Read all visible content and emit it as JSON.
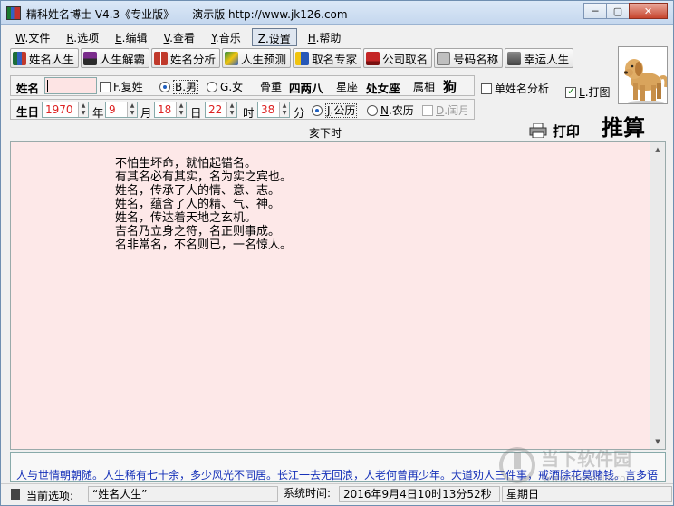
{
  "window": {
    "title": "精科姓名博士 V4.3《专业版》 - - 演示版 http://www.jk126.com",
    "min_glyph": "─",
    "max_glyph": "▢",
    "close_glyph": "✕"
  },
  "menu": [
    {
      "key": "W",
      "label": ".文件"
    },
    {
      "key": "R",
      "label": ".选项"
    },
    {
      "key": "E",
      "label": ".编辑"
    },
    {
      "key": "V",
      "label": ".查看"
    },
    {
      "key": "Y",
      "label": ".音乐"
    },
    {
      "key": "Z",
      "label": ".设置"
    },
    {
      "key": "H",
      "label": ".帮助"
    }
  ],
  "toolbar": [
    {
      "label": "姓名人生",
      "icon": "books-icon",
      "color": "#1d6e3a"
    },
    {
      "label": "人生解霸",
      "icon": "book-stack-icon",
      "color": "#7a2c8c"
    },
    {
      "label": "姓名分析",
      "icon": "open-book-icon",
      "color": "#b8402f"
    },
    {
      "label": "人生预测",
      "icon": "crystal-icon",
      "color": "#2b8c3e"
    },
    {
      "label": "取名专家",
      "icon": "expert-book-icon",
      "color": "#2758b8"
    },
    {
      "label": "公司取名",
      "icon": "company-book-icon",
      "color": "#c42525"
    },
    {
      "label": "号码名称",
      "icon": "tag-icon",
      "color": "#8a8a8a"
    },
    {
      "label": "幸运人生",
      "icon": "luck-book-icon",
      "color": "#6b6b6b"
    }
  ],
  "name_row": {
    "name_label": "姓名",
    "name_value": "",
    "compound_key": "F",
    "compound_label": ".复姓",
    "male_key": "B",
    "male_label": ".男",
    "female_key": "G",
    "female_label": ".女",
    "weight_label": "骨重",
    "weight_value": "四两八",
    "star_label": "星座",
    "star_value": "处女座",
    "zodiac_label": "属相",
    "zodiac_value": "狗"
  },
  "birth_row": {
    "label": "生日",
    "year": "1970",
    "year_unit": "年",
    "month": "9",
    "month_unit": "月",
    "day": "18",
    "day_unit": "日",
    "hour": "22",
    "hour_unit": "时",
    "minute": "38",
    "minute_unit": "分",
    "solar_key": "J",
    "solar_label": ".公历",
    "lunar_key": "N",
    "lunar_label": ".农历",
    "leap_key": "D",
    "leap_label": ".闰月"
  },
  "options": {
    "single_name_label": "单姓名分析",
    "print_chart_key": "L",
    "print_chart_label": ".打图"
  },
  "hour_branch": "亥下时",
  "print_label": "打印",
  "calc_label": "推算",
  "poem": [
    "不怕生坏命，就怕起错名。",
    "有其名必有其实，名为实之宾也。",
    "姓名，传承了人的情、意、志。",
    "姓名，蕴含了人的精、气、神。",
    "姓名，传达着天地之玄机。",
    "吉名乃立身之符，名正则事成。",
    "名非常名，不名则已，一名惊人。"
  ],
  "marquee": "人与世情朝朝随。人生稀有七十余，多少风光不同居。长江一去无回浪，人老何曾再少年。大道劝人三件事，戒酒除花莫赌钱。言多语",
  "status": {
    "current_label": "当前选项:",
    "current_value": "“姓名人生”",
    "time_label": "系统时间:",
    "time_value": "2016年9月4日10时13分52秒",
    "weekday": "星期日"
  },
  "watermark": {
    "text": "当下软件园",
    "sub": "www.downxia.com"
  }
}
